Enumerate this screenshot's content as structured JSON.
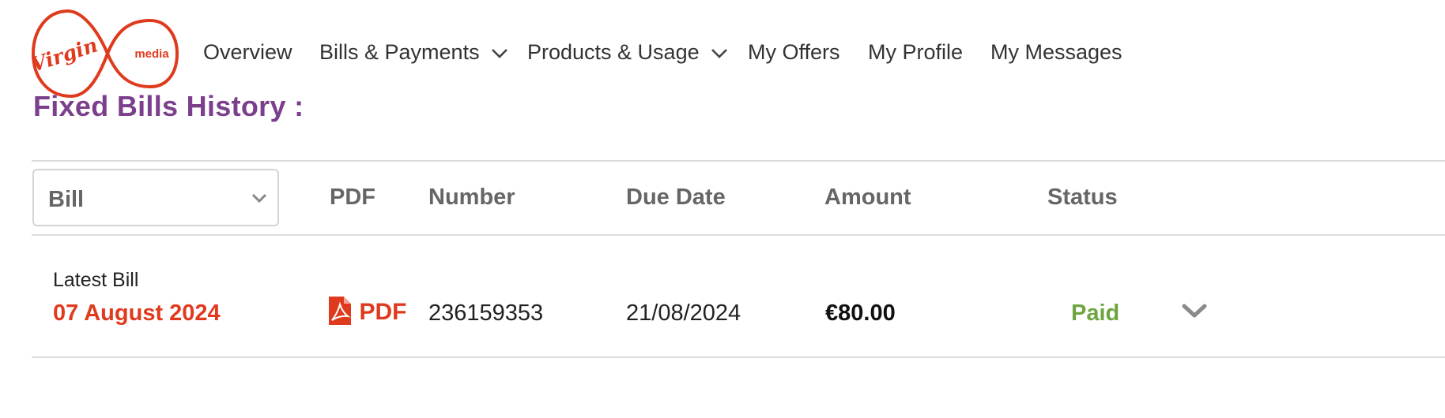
{
  "brand": {
    "logo_icon": "virgin-media-logo",
    "logo_script": "Virgin",
    "logo_word": "media",
    "color": "#e03a1e"
  },
  "nav": {
    "items": [
      {
        "label": "Overview",
        "has_dropdown": false
      },
      {
        "label": "Bills & Payments",
        "has_dropdown": true
      },
      {
        "label": "Products & Usage",
        "has_dropdown": true
      },
      {
        "label": "My Offers",
        "has_dropdown": false
      },
      {
        "label": "My Profile",
        "has_dropdown": false
      },
      {
        "label": "My Messages",
        "has_dropdown": false
      }
    ]
  },
  "section": {
    "title": "Fixed Bills History :",
    "title_color": "#7b3f8c"
  },
  "table": {
    "filter": {
      "selected": "Bill",
      "icon": "chevron-down-icon"
    },
    "columns": [
      "PDF",
      "Number",
      "Due Date",
      "Amount",
      "Status"
    ],
    "rows": [
      {
        "label": "Latest Bill",
        "bill_date": "07 August 2024",
        "pdf_label": "PDF",
        "pdf_icon": "pdf-file-icon",
        "number": "236159353",
        "due_date": "21/08/2024",
        "amount": "€80.00",
        "status": "Paid",
        "status_color": "#6ea540",
        "expand_icon": "chevron-down-icon"
      }
    ]
  }
}
